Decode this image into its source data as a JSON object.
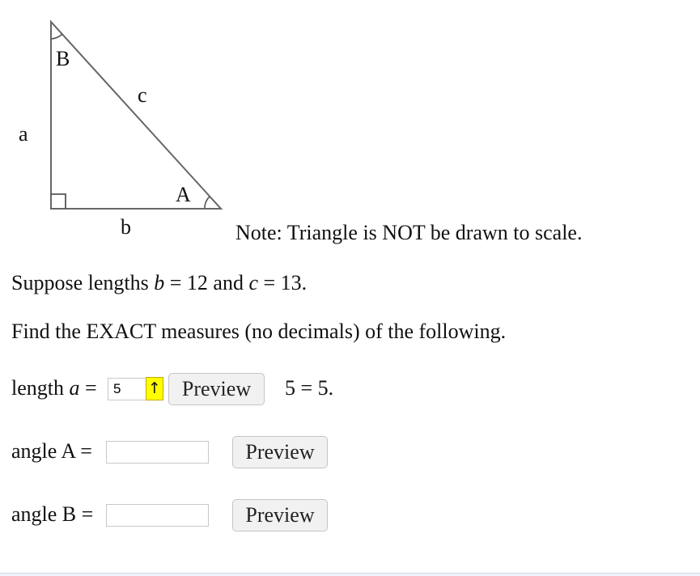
{
  "figure": {
    "vertex_B": "B",
    "side_c": "c",
    "side_a": "a",
    "vertex_A": "A",
    "side_b": "b"
  },
  "note": "Note: Triangle is NOT be drawn to scale.",
  "given": {
    "prefix": "Suppose lengths ",
    "var1": "b",
    "eq1": " = 12 and ",
    "var2": "c",
    "eq2": " = 13."
  },
  "instruction": "Find the EXACT measures (no decimals) of the following.",
  "questions": {
    "length_a": {
      "label_prefix": "length ",
      "label_var": "a",
      "label_eq": " = ",
      "value": "5",
      "arrow_icon": "↑",
      "preview_label": "Preview",
      "result": "5 = 5."
    },
    "angle_A": {
      "label": "angle A =",
      "value": "",
      "preview_label": "Preview"
    },
    "angle_B": {
      "label": "angle B =",
      "value": "",
      "preview_label": "Preview"
    }
  },
  "colors": {
    "warning_button": "#ffff00",
    "page_background": "#ffffff",
    "triangle_stroke": "#666666"
  }
}
